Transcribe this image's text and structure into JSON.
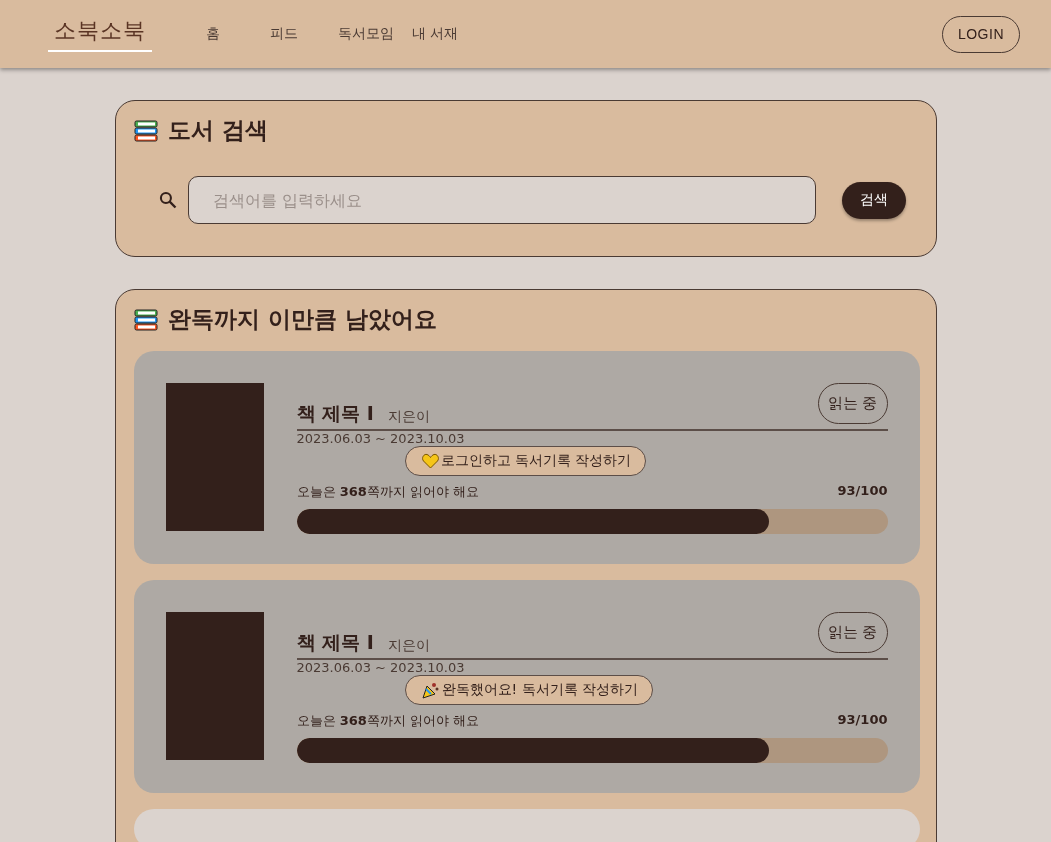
{
  "header": {
    "logo": "소북소북",
    "nav": [
      {
        "label": "홈"
      },
      {
        "label": "피드"
      },
      {
        "label": "독서모임"
      },
      {
        "label": "내 서재"
      }
    ],
    "login": "LOGIN"
  },
  "search": {
    "title": "도서 검색",
    "placeholder": "검색어를 입력하세요",
    "button": "검색"
  },
  "progress": {
    "title": "완독까지 이만큼 남았어요",
    "books": [
      {
        "kind": "book",
        "title": "책 제목 I",
        "author": "지은이",
        "status": "읽는 중",
        "dates": "2023.06.03 ~ 2023.10.03",
        "goal": "오늘은 **368**쪽까지 읽어야 해요",
        "score": "93/100",
        "level": 0.8,
        "popup": {
          "kind": "login",
          "text": "로그인하고 독서기록 작성하기"
        }
      },
      {
        "kind": "book",
        "title": "책 제목 I",
        "author": "지은이",
        "status": "읽는 중",
        "dates": "2023.06.03 ~ 2023.10.03",
        "goal": "오늘은 **368**쪽까지 읽어야 해요",
        "score": "93/100",
        "level": 0.8,
        "popup": {
          "kind": "finished",
          "text": "완독했어요! 독서기록 작성하기"
        }
      },
      {
        "kind": "empty"
      }
    ]
  }
}
